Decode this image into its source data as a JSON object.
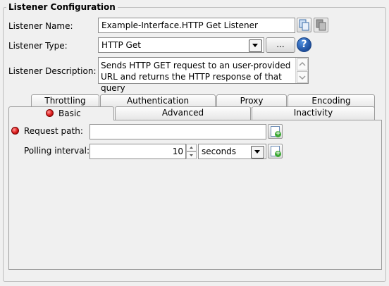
{
  "group": {
    "title": "Listener Configuration"
  },
  "listener_name": {
    "label": "Listener Name:",
    "value": "Example-Interface.HTTP Get Listener"
  },
  "listener_type": {
    "label": "Listener Type:",
    "value": "HTTP Get",
    "browse_label": "...",
    "help_icon": "?"
  },
  "listener_description": {
    "label": "Listener Description:",
    "value": "Sends HTTP GET request to an user-provided URL and returns the HTTP response of that query"
  },
  "tabs": {
    "row_back": [
      "Throttling",
      "Authentication",
      "Proxy",
      "Encoding"
    ],
    "row_front": [
      "Basic",
      "Advanced",
      "Inactivity"
    ],
    "active": "Basic"
  },
  "basic": {
    "request_path": {
      "label": "Request path:",
      "value": ""
    },
    "polling_interval": {
      "label": "Polling interval:",
      "value": "10",
      "unit": "seconds"
    }
  },
  "icons": {
    "copy": "copy-icon",
    "paste": "paste-icon",
    "help": "help-icon",
    "required": "required-indicator-icon",
    "add": "add-variable-icon"
  }
}
